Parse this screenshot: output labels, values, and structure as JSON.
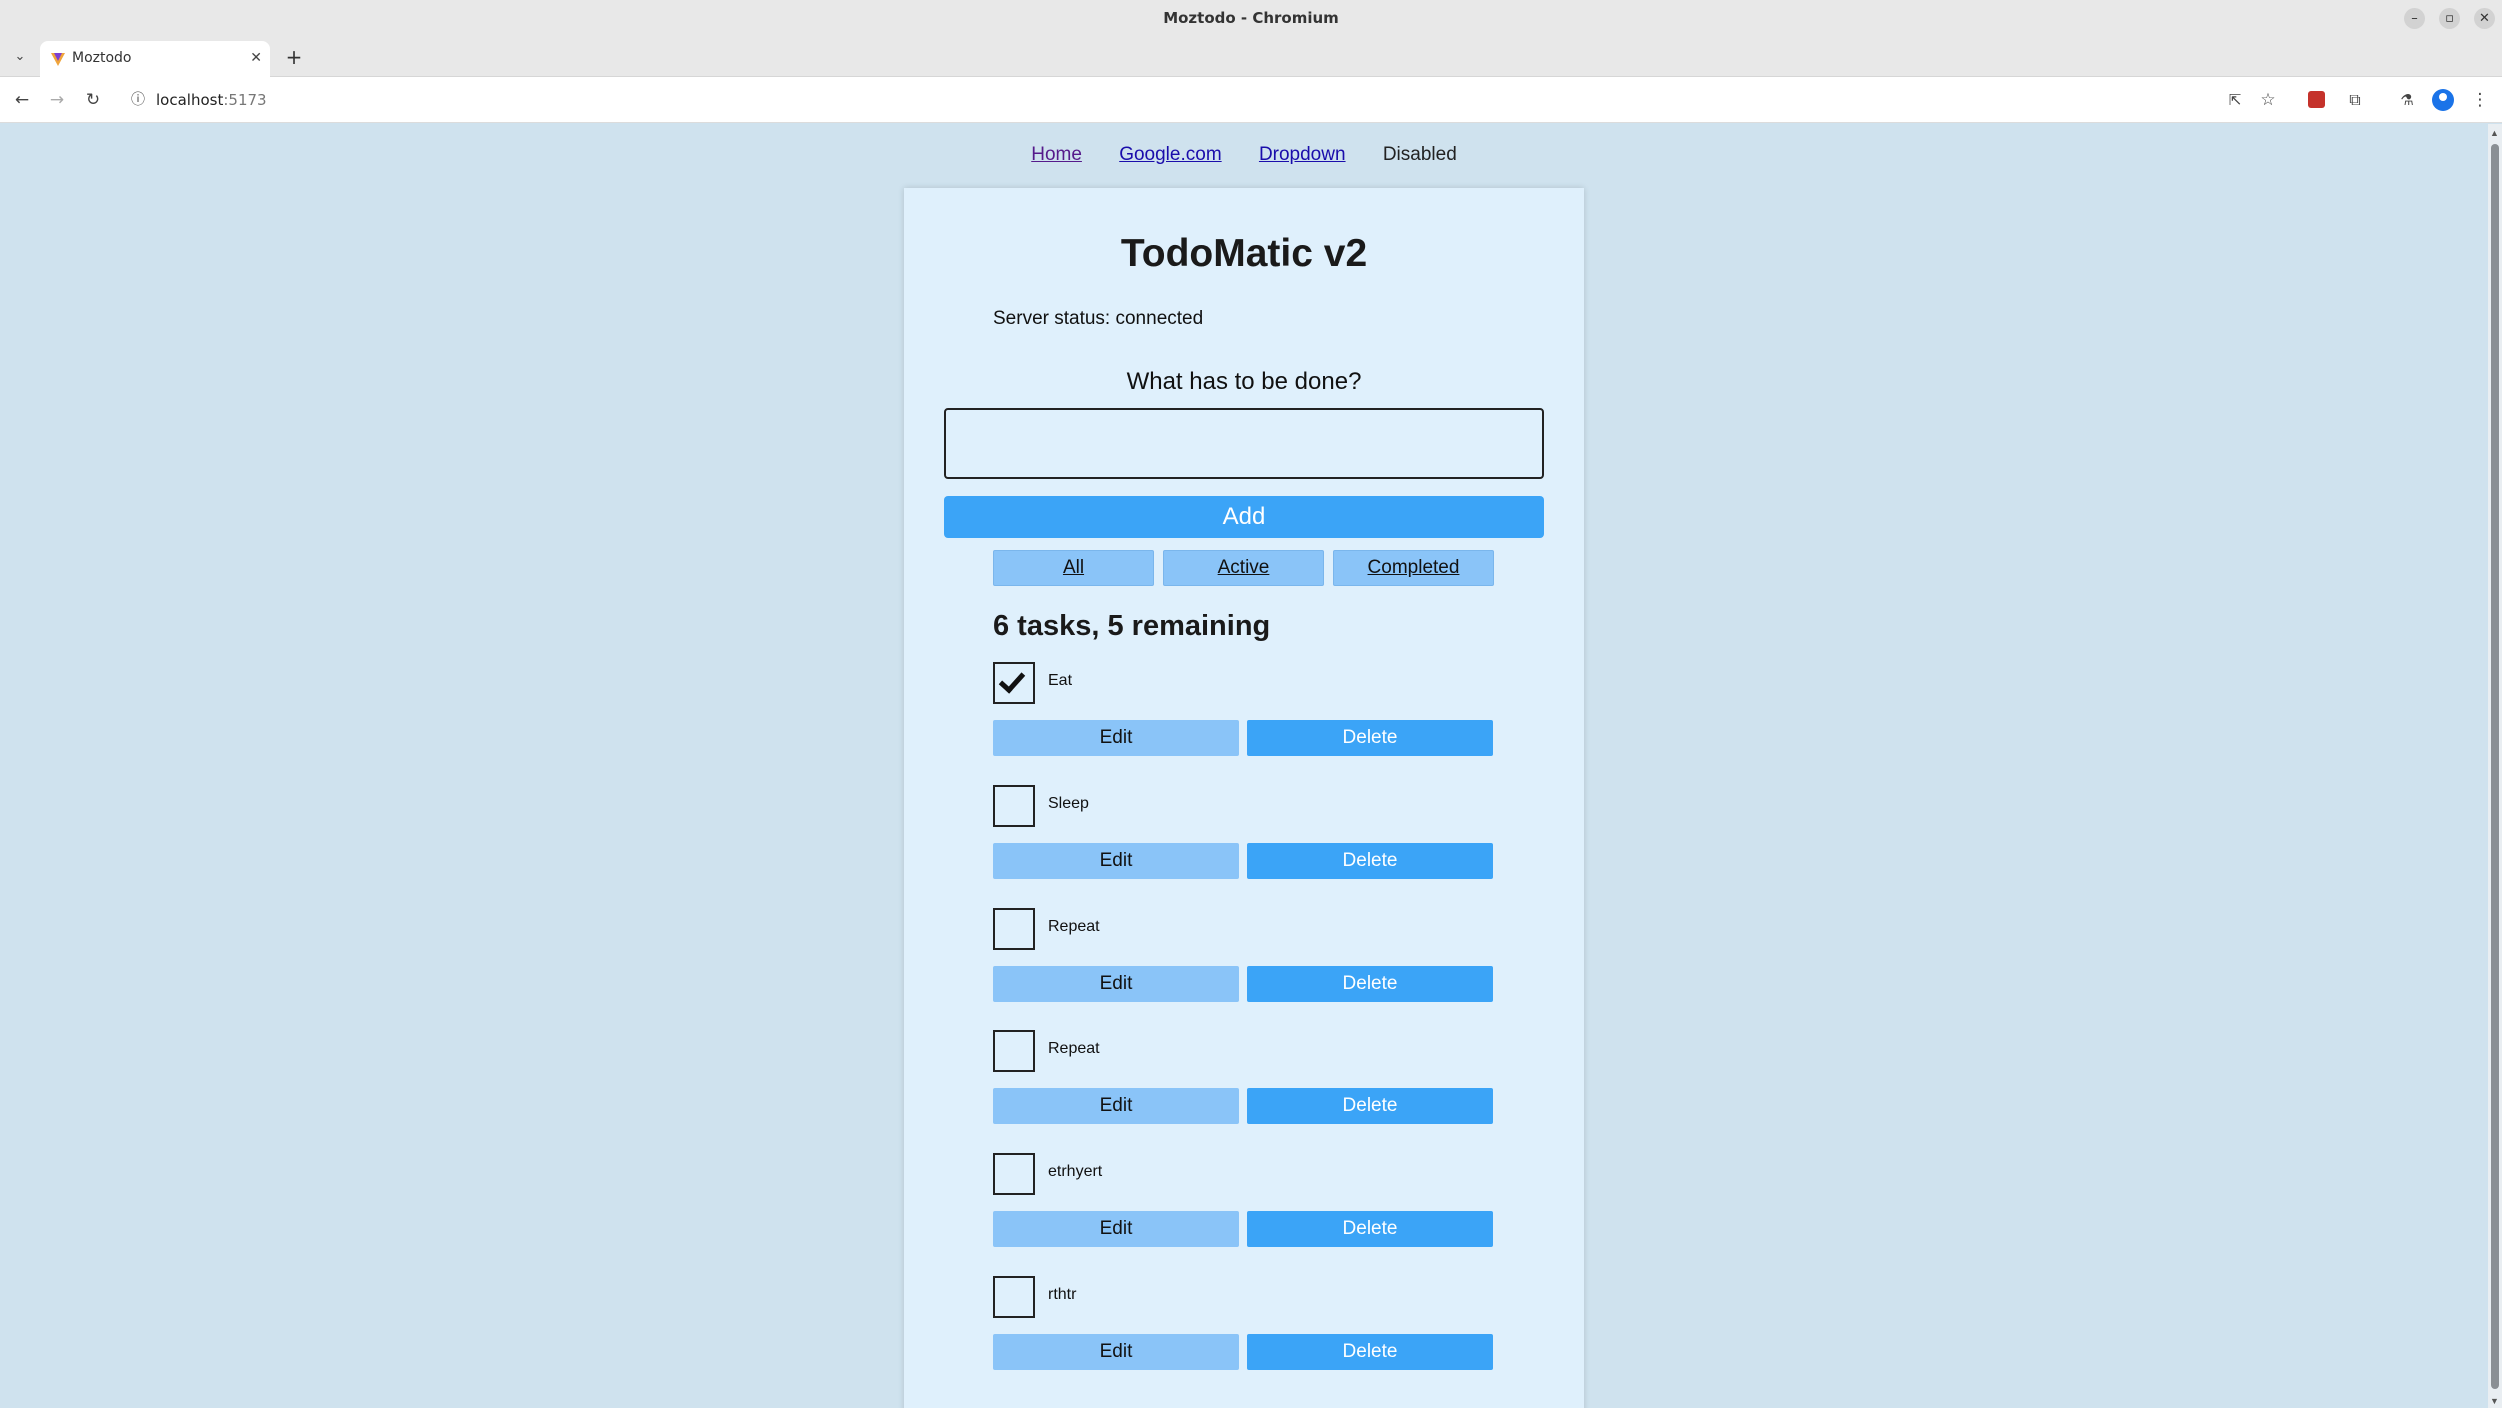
{
  "window": {
    "title": "Moztodo - Chromium",
    "controls": [
      "minimize",
      "maximize",
      "close"
    ]
  },
  "tabs": [
    {
      "title": "Moztodo",
      "active": true
    }
  ],
  "toolbar": {
    "url_host": "localhost",
    "url_port": ":5173"
  },
  "nav": {
    "links": [
      {
        "label": "Home",
        "visited": true
      },
      {
        "label": "Google.com"
      },
      {
        "label": "Dropdown"
      }
    ],
    "disabled_label": "Disabled"
  },
  "app": {
    "title": "TodoMatic v2",
    "server_status": "Server status: connected",
    "prompt": "What has to be done?",
    "input_value": "",
    "add_label": "Add",
    "filters": [
      "All",
      "Active",
      "Completed"
    ],
    "count_heading": "6 tasks, 5 remaining",
    "edit_label": "Edit",
    "delete_label": "Delete",
    "todos": [
      {
        "name": "Eat",
        "completed": true
      },
      {
        "name": "Sleep",
        "completed": false
      },
      {
        "name": "Repeat",
        "completed": false
      },
      {
        "name": "Repeat",
        "completed": false
      },
      {
        "name": "etrhyert",
        "completed": false
      },
      {
        "name": "rthtr",
        "completed": false
      }
    ]
  },
  "colors": {
    "page_bg": "#cfe2ee",
    "card_bg": "#dff0fc",
    "primary_button": "#3ba4f7",
    "secondary_button": "#8ac4f8"
  }
}
